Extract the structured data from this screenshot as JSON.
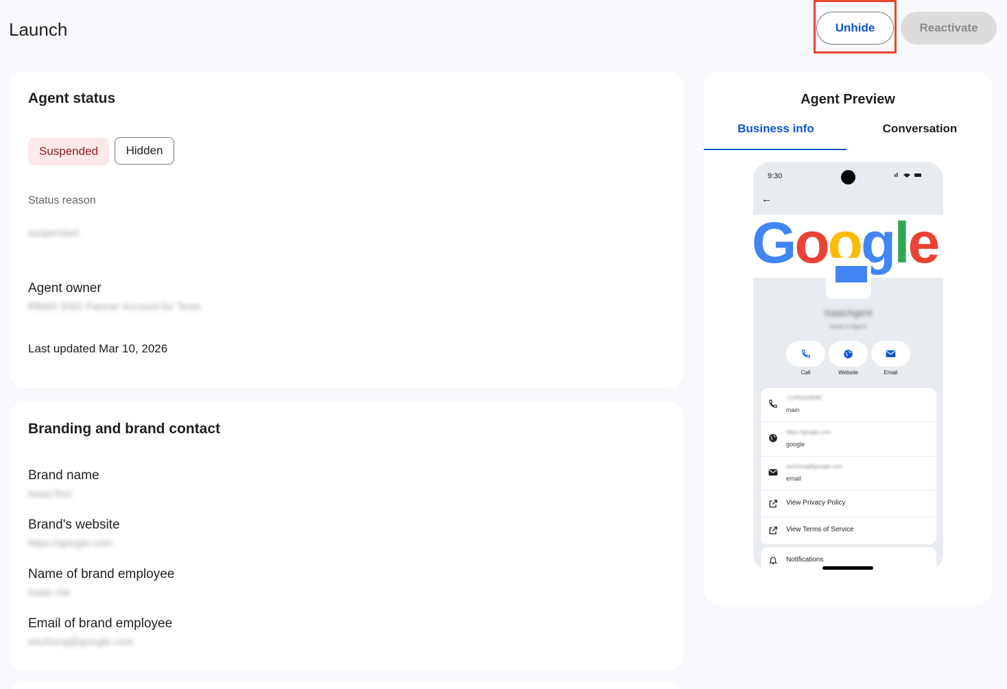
{
  "page": {
    "title": "Launch"
  },
  "actions": {
    "unhide_label": "Unhide",
    "reactivate_label": "Reactivate"
  },
  "agent_status": {
    "title": "Agent status",
    "chips": {
      "suspended": "Suspended",
      "hidden": "Hidden"
    },
    "status_reason_label": "Status reason",
    "status_reason_value": "suspended",
    "owner_label": "Agent owner",
    "owner_value": "RBMX ENG Partner Account for Tests",
    "last_updated": "Last updated Mar 10, 2026"
  },
  "branding": {
    "title": "Branding and brand contact",
    "brand_name_label": "Brand name",
    "brand_name_value": "IsaacTest",
    "website_label": "Brand's website",
    "website_value": "https://google.com",
    "employee_name_label": "Name of brand employee",
    "employee_name_value": "Isaac Xie",
    "employee_email_label": "Email of brand employee",
    "employee_email_value": "xiezhong@google.com"
  },
  "preview": {
    "title": "Agent Preview",
    "tabs": [
      {
        "label": "Business info",
        "active": true
      },
      {
        "label": "Conversation",
        "active": false
      }
    ],
    "phone": {
      "time": "9:30",
      "agent_name": "IsaacAgent",
      "agent_subtitle": "Isaac's Agent",
      "logo_text": "Google",
      "actions": [
        {
          "label": "Call",
          "icon": "phone-icon"
        },
        {
          "label": "Website",
          "icon": "globe-icon"
        },
        {
          "label": "Email",
          "icon": "mail-icon"
        }
      ],
      "contacts": [
        {
          "icon": "phone-icon",
          "value": "+14055548397",
          "label": "main"
        },
        {
          "icon": "globe-icon",
          "value": "https://google.com",
          "label": "google"
        },
        {
          "icon": "mail-icon",
          "value": "xiezhong@google.com",
          "label": "email"
        }
      ],
      "links": [
        {
          "icon": "external-link-icon",
          "label": "View Privacy Policy"
        },
        {
          "icon": "external-link-icon",
          "label": "View Terms of Service"
        }
      ],
      "notifications_label": "Notifications"
    }
  },
  "colors": {
    "accent": "#0b57d0",
    "suspended_bg": "#fce8e8",
    "suspended_text": "#8c1d18",
    "highlight": "#e8442a"
  }
}
